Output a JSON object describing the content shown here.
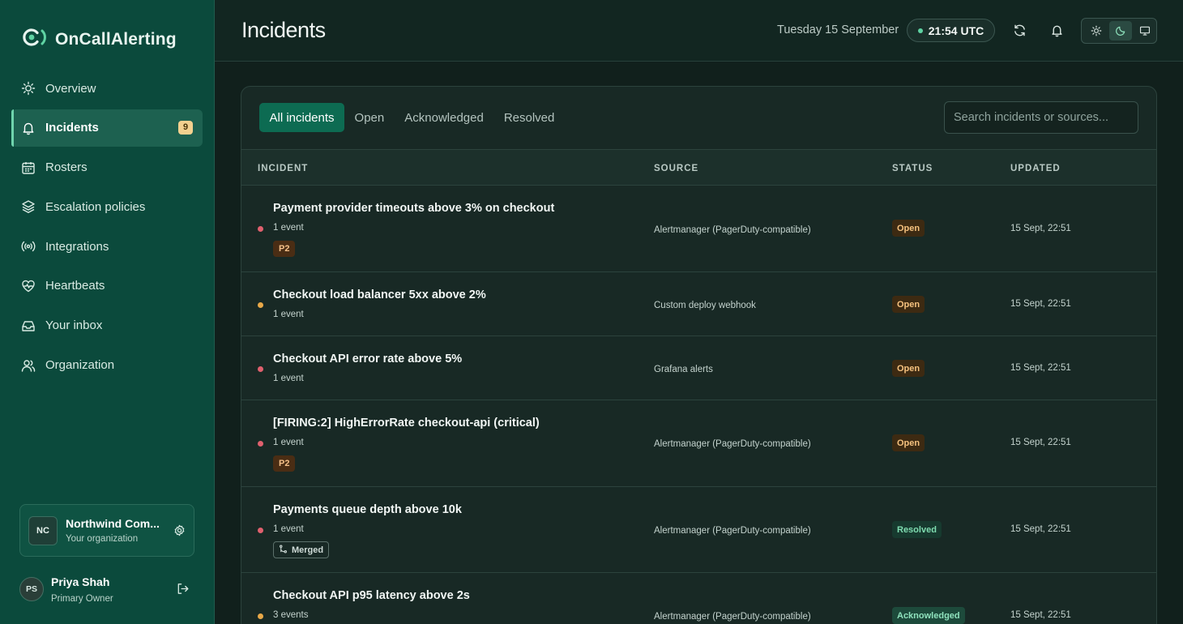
{
  "app": {
    "name": "OnCallAlerting"
  },
  "sidebar": {
    "items": [
      {
        "label": "Overview",
        "icon": "sun-icon"
      },
      {
        "label": "Incidents",
        "icon": "bell-icon",
        "badge": "9",
        "active": true
      },
      {
        "label": "Rosters",
        "icon": "calendar-icon"
      },
      {
        "label": "Escalation policies",
        "icon": "layers-icon"
      },
      {
        "label": "Integrations",
        "icon": "broadcast-icon"
      },
      {
        "label": "Heartbeats",
        "icon": "heart-pulse-icon"
      },
      {
        "label": "Your inbox",
        "icon": "inbox-icon"
      },
      {
        "label": "Organization",
        "icon": "users-icon"
      }
    ],
    "org": {
      "initials": "NC",
      "name": "Northwind Com...",
      "subtitle": "Your organization"
    },
    "user": {
      "initials": "PS",
      "name": "Priya Shah",
      "role": "Primary Owner"
    }
  },
  "header": {
    "title": "Incidents",
    "date": "Tuesday 15 September",
    "time": "21:54 UTC"
  },
  "incidents": {
    "tabs": [
      "All incidents",
      "Open",
      "Acknowledged",
      "Resolved"
    ],
    "active_tab": "All incidents",
    "search_placeholder": "Search incidents or sources...",
    "columns": [
      "INCIDENT",
      "SOURCE",
      "STATUS",
      "UPDATED"
    ],
    "rows": [
      {
        "title": "Payment provider timeouts above 3% on checkout",
        "events": "1 event",
        "tag": "P2",
        "source": "Alertmanager (PagerDuty-compatible)",
        "status": "Open",
        "updated": "15 Sept, 22:51",
        "dot_color": "#e0606e"
      },
      {
        "title": "Checkout load balancer 5xx above 2%",
        "events": "1 event",
        "source": "Custom deploy webhook",
        "status": "Open",
        "updated": "15 Sept, 22:51",
        "dot_color": "#e8a848"
      },
      {
        "title": "Checkout API error rate above 5%",
        "events": "1 event",
        "source": "Grafana alerts",
        "status": "Open",
        "updated": "15 Sept, 22:51",
        "dot_color": "#e0606e"
      },
      {
        "title": "[FIRING:2] HighErrorRate checkout-api (critical)",
        "events": "1 event",
        "tag": "P2",
        "source": "Alertmanager (PagerDuty-compatible)",
        "status": "Open",
        "updated": "15 Sept, 22:51",
        "dot_color": "#e0606e"
      },
      {
        "title": "Payments queue depth above 10k",
        "events": "1 event",
        "merged": "Merged",
        "source": "Alertmanager (PagerDuty-compatible)",
        "status": "Resolved",
        "updated": "15 Sept, 22:51",
        "dot_color": "#e0606e"
      },
      {
        "title": "Checkout API p95 latency above 2s",
        "events": "3 events",
        "source": "Alertmanager (PagerDuty-compatible)",
        "status": "Acknowledged",
        "updated": "15 Sept, 22:51",
        "dot_color": "#e8a848"
      }
    ]
  },
  "colors": {
    "accent": "#0d6b52",
    "sidebar": "#0b4a3c",
    "badge": "#f3d18f"
  }
}
